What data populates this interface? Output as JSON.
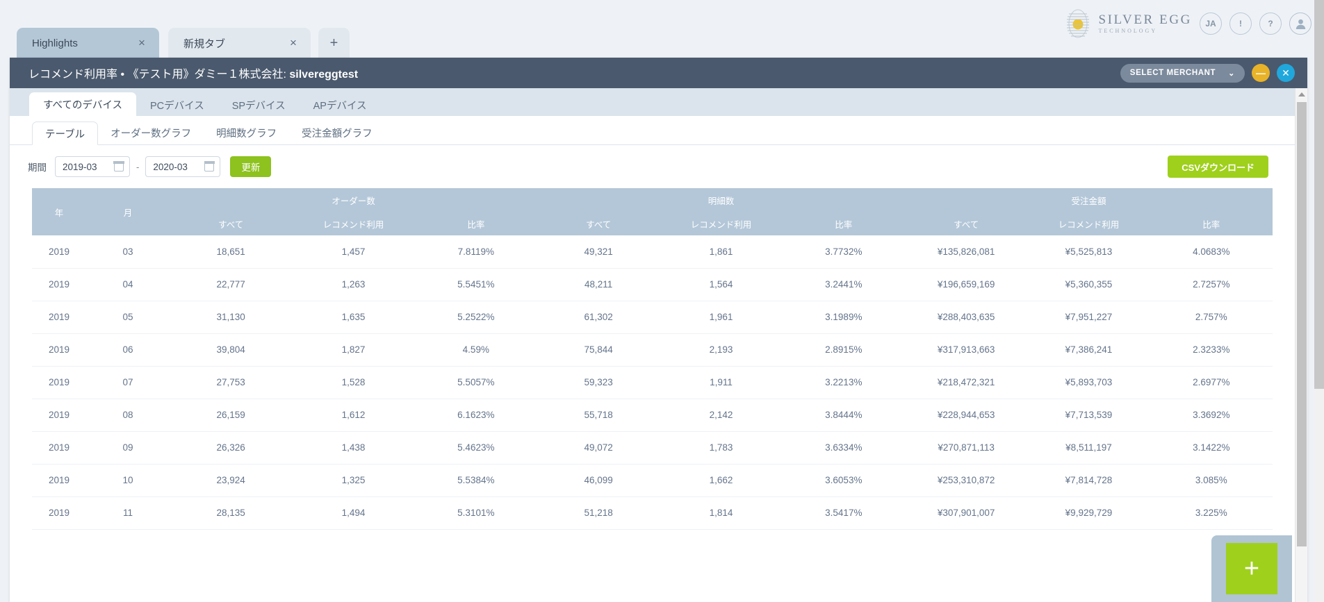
{
  "browser": {
    "tabs": [
      {
        "label": "Highlights",
        "close": "×",
        "active": true
      },
      {
        "label": "新規タブ",
        "close": "×",
        "active": false
      }
    ],
    "new_tab": "+"
  },
  "brand": {
    "logo_line1": "SILVER EGG",
    "logo_line2": "TECHNOLOGY",
    "lang_button": "JA",
    "alert_button": "!",
    "help_button": "?",
    "avatar_icon": "user-icon",
    "logo_yolk_color": "#f5c518",
    "logo_line_color": "#b9c4cf"
  },
  "window": {
    "title_main": "レコメンド利用率 • 《テスト用》ダミー１株式会社: ",
    "title_merchant": "silvereggtest",
    "select_merchant": "SELECT MERCHANT",
    "chevron": "⌄",
    "minimize": "—",
    "close": "✕",
    "titlebar_color": "#4a596d",
    "minimize_color": "#e8b328",
    "close_color": "#20a8dc"
  },
  "device_tabs": [
    {
      "label": "すべてのデバイス",
      "active": true
    },
    {
      "label": "PCデバイス",
      "active": false
    },
    {
      "label": "SPデバイス",
      "active": false
    },
    {
      "label": "APデバイス",
      "active": false
    }
  ],
  "view_tabs": [
    {
      "label": "テーブル",
      "active": true
    },
    {
      "label": "オーダー数グラフ",
      "active": false
    },
    {
      "label": "明細数グラフ",
      "active": false
    },
    {
      "label": "受注金額グラフ",
      "active": false
    }
  ],
  "toolbar": {
    "period_label": "期間",
    "date_from": "2019-03",
    "date_to": "2020-03",
    "separator": "-",
    "update_button": "更新",
    "csv_button": "CSVダウンロード",
    "update_color": "#8dc21f",
    "csv_color": "#9fd01c"
  },
  "table": {
    "header_color": "#b4c7d8",
    "col_year": "年",
    "col_month": "月",
    "groups": [
      {
        "label": "オーダー数"
      },
      {
        "label": "明細数"
      },
      {
        "label": "受注金額"
      }
    ],
    "sub_all": "すべて",
    "sub_reco": "レコメンド利用",
    "sub_ratio": "比率",
    "rows": [
      {
        "year": "2019",
        "month": "03",
        "o_all": "18,651",
        "o_reco": "1,457",
        "o_ratio": "7.8119%",
        "d_all": "49,321",
        "d_reco": "1,861",
        "d_ratio": "3.7732%",
        "a_all": "¥135,826,081",
        "a_reco": "¥5,525,813",
        "a_ratio": "4.0683%"
      },
      {
        "year": "2019",
        "month": "04",
        "o_all": "22,777",
        "o_reco": "1,263",
        "o_ratio": "5.5451%",
        "d_all": "48,211",
        "d_reco": "1,564",
        "d_ratio": "3.2441%",
        "a_all": "¥196,659,169",
        "a_reco": "¥5,360,355",
        "a_ratio": "2.7257%"
      },
      {
        "year": "2019",
        "month": "05",
        "o_all": "31,130",
        "o_reco": "1,635",
        "o_ratio": "5.2522%",
        "d_all": "61,302",
        "d_reco": "1,961",
        "d_ratio": "3.1989%",
        "a_all": "¥288,403,635",
        "a_reco": "¥7,951,227",
        "a_ratio": "2.757%"
      },
      {
        "year": "2019",
        "month": "06",
        "o_all": "39,804",
        "o_reco": "1,827",
        "o_ratio": "4.59%",
        "d_all": "75,844",
        "d_reco": "2,193",
        "d_ratio": "2.8915%",
        "a_all": "¥317,913,663",
        "a_reco": "¥7,386,241",
        "a_ratio": "2.3233%"
      },
      {
        "year": "2019",
        "month": "07",
        "o_all": "27,753",
        "o_reco": "1,528",
        "o_ratio": "5.5057%",
        "d_all": "59,323",
        "d_reco": "1,911",
        "d_ratio": "3.2213%",
        "a_all": "¥218,472,321",
        "a_reco": "¥5,893,703",
        "a_ratio": "2.6977%"
      },
      {
        "year": "2019",
        "month": "08",
        "o_all": "26,159",
        "o_reco": "1,612",
        "o_ratio": "6.1623%",
        "d_all": "55,718",
        "d_reco": "2,142",
        "d_ratio": "3.8444%",
        "a_all": "¥228,944,653",
        "a_reco": "¥7,713,539",
        "a_ratio": "3.3692%"
      },
      {
        "year": "2019",
        "month": "09",
        "o_all": "26,326",
        "o_reco": "1,438",
        "o_ratio": "5.4623%",
        "d_all": "49,072",
        "d_reco": "1,783",
        "d_ratio": "3.6334%",
        "a_all": "¥270,871,113",
        "a_reco": "¥8,511,197",
        "a_ratio": "3.1422%"
      },
      {
        "year": "2019",
        "month": "10",
        "o_all": "23,924",
        "o_reco": "1,325",
        "o_ratio": "5.5384%",
        "d_all": "46,099",
        "d_reco": "1,662",
        "d_ratio": "3.6053%",
        "a_all": "¥253,310,872",
        "a_reco": "¥7,814,728",
        "a_ratio": "3.085%"
      },
      {
        "year": "2019",
        "month": "11",
        "o_all": "28,135",
        "o_reco": "1,494",
        "o_ratio": "5.3101%",
        "d_all": "51,218",
        "d_reco": "1,814",
        "d_ratio": "3.5417%",
        "a_all": "¥307,901,007",
        "a_reco": "¥9,929,729",
        "a_ratio": "3.225%"
      }
    ]
  },
  "fab": {
    "icon": "+",
    "color": "#9fd01c"
  }
}
